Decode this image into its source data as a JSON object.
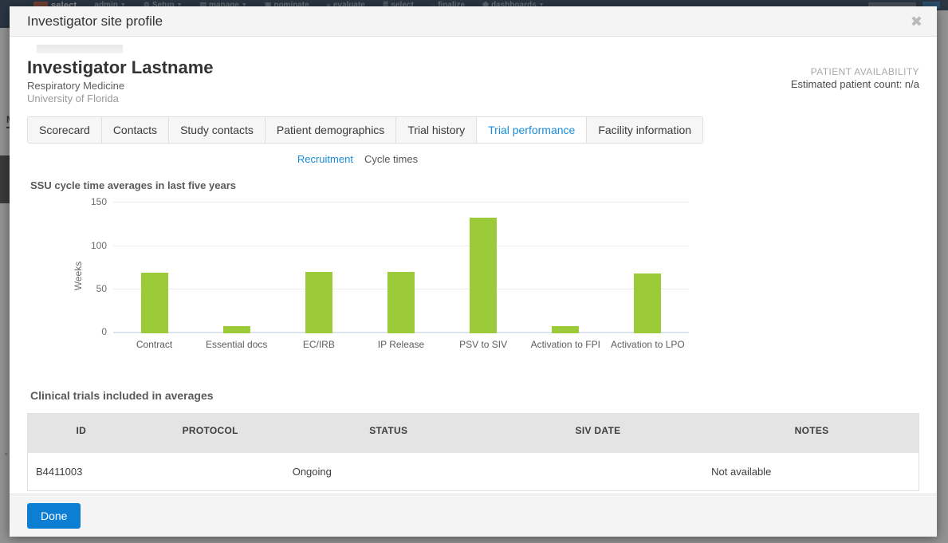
{
  "background_app": {
    "brand": "select",
    "nav_items": [
      {
        "label": "admin",
        "glyph": "",
        "caret": "▼"
      },
      {
        "label": "Setup",
        "glyph": "⚙",
        "caret": "▼"
      },
      {
        "label": "manage",
        "glyph": "▤",
        "caret": "▼"
      },
      {
        "label": "nominate",
        "glyph": "▣",
        "caret": ""
      },
      {
        "label": "evaluate",
        "glyph": "⌕",
        "caret": ""
      },
      {
        "label": "select",
        "glyph": "≣",
        "caret": ""
      },
      {
        "label": "finalize",
        "glyph": "○",
        "caret": ""
      },
      {
        "label": "dashboards",
        "glyph": "⬟",
        "caret": "▼"
      }
    ],
    "menu_label": "M",
    "footer_note": "*"
  },
  "modal": {
    "title": "Investigator site profile",
    "close_label": "✖",
    "profile": {
      "name": "Investigator Lastname",
      "department": "Respiratory Medicine",
      "organization": "University of Florida"
    },
    "availability": {
      "title": "PATIENT AVAILABILITY",
      "value": "Estimated patient count: n/a"
    },
    "tabs": [
      {
        "label": "Scorecard",
        "active": false
      },
      {
        "label": "Contacts",
        "active": false
      },
      {
        "label": "Study contacts",
        "active": false
      },
      {
        "label": "Patient demographics",
        "active": false
      },
      {
        "label": "Trial history",
        "active": false
      },
      {
        "label": "Trial performance",
        "active": true
      },
      {
        "label": "Facility information",
        "active": false
      }
    ],
    "sub_tabs": [
      {
        "label": "Recruitment",
        "active": false
      },
      {
        "label": "Cycle times",
        "active": true
      }
    ],
    "table_heading": "Clinical trials included in averages",
    "table": {
      "columns": [
        "ID",
        "PROTOCOL",
        "STATUS",
        "SIV DATE",
        "NOTES"
      ],
      "rows": [
        {
          "id": "B4411003",
          "protocol": "",
          "status": "Ongoing",
          "siv_date": "",
          "notes": "Not available"
        }
      ]
    },
    "footer": {
      "done_label": "Done"
    }
  },
  "colors": {
    "bar_green": "#9bcb39",
    "accent_blue": "#1a8cd8",
    "button_blue": "#0d7fd3",
    "nav_navy": "#16304d"
  },
  "chart_data": {
    "type": "bar",
    "title": "SSU cycle time averages in last five years",
    "xlabel": "",
    "ylabel": "Weeks",
    "categories": [
      "Contract",
      "Essential docs",
      "EC/IRB",
      "IP Release",
      "PSV to SIV",
      "Activation to FPI",
      "Activation to LPO"
    ],
    "values": [
      70,
      8,
      71,
      71,
      133,
      8,
      69
    ],
    "ylim": [
      0,
      150
    ],
    "yticks": [
      0,
      50,
      100,
      150
    ],
    "grid": true,
    "legend": false,
    "series_color": "#9bcb39"
  }
}
